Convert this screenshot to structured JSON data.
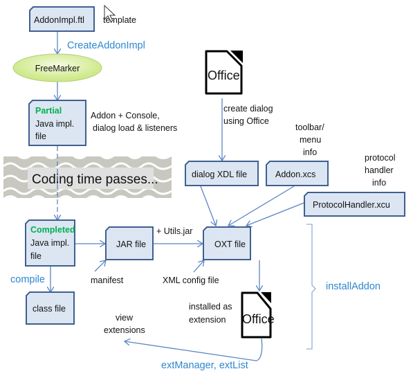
{
  "colors": {
    "box_fill": "#dce6f2",
    "box_stroke": "#3f5f8f",
    "arrow": "#5b85c4",
    "label_blue": "#2e86d0",
    "status_green": "#00b050",
    "freemarker_fill": "#d7eea0"
  },
  "nodes": {
    "template_file": "AddonImpl.ftl",
    "template_note": "template",
    "freemarker": "FreeMarker",
    "partial": {
      "status": "Partial",
      "line1": "Java impl.",
      "line2": "file"
    },
    "partial_note": [
      "Addon +  Console,",
      "dialog load & listeners"
    ],
    "coding_time": "Coding time passes...",
    "completed": {
      "status": "Completed",
      "line1": "Java impl.",
      "line2": "file"
    },
    "class_file": "class file",
    "jar_file": "JAR file",
    "oxt_file": "OXT file",
    "dialog_xdl": "dialog XDL file",
    "addon_xcs": "Addon.xcs",
    "protocol_handler": "ProtocolHandler.xcu",
    "office_top": "Office",
    "office_bottom": "Office"
  },
  "labels": {
    "create_addon_impl": "CreateAddonImpl",
    "create_dialog": [
      "create dialog",
      "using Office"
    ],
    "toolbar_info": [
      "toolbar/",
      "menu",
      "info"
    ],
    "protocol_info": [
      "protocol",
      "handler",
      "info"
    ],
    "utils_jar": "+ Utils.jar",
    "compile": "compile",
    "manifest": "manifest",
    "xml_config": "XML config file",
    "installed_as": [
      "installed as",
      "extension"
    ],
    "install_addon": "installAddon",
    "view_extensions": [
      "view",
      "extensions"
    ],
    "ext_manager": "extManager,  extList"
  },
  "icons": {
    "pointer": "mouse-cursor-icon",
    "office": "libreoffice-document-icon"
  }
}
